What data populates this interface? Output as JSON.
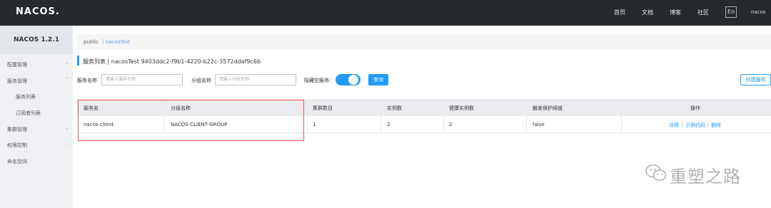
{
  "header": {
    "logo": "NACOS.",
    "nav": [
      "首页",
      "文档",
      "博客",
      "社区"
    ],
    "lang": "En",
    "user": "nacos"
  },
  "sidebar": {
    "version": "NACOS 1.2.1",
    "items": [
      {
        "label": "配置管理",
        "chevron": "⌄"
      },
      {
        "label": "服务管理",
        "chevron": "⌃"
      },
      {
        "label": "服务列表"
      },
      {
        "label": "订阅者列表"
      },
      {
        "label": "集群管理",
        "chevron": "⌄"
      },
      {
        "label": "权限控制",
        "chevron": "⌄"
      },
      {
        "label": "命名空间"
      }
    ]
  },
  "breadcrumb": {
    "public": "public",
    "sep": "|",
    "namespace": "nacosTest"
  },
  "page": {
    "title": "服务列表  |  nacosTest  9403ddc2-f9b1-4220-b22c-3572ddaf9c6b"
  },
  "filters": {
    "service_label": "服务名称",
    "service_placeholder": "请输入服务名称",
    "group_label": "分组名称",
    "group_placeholder": "请输入分组名称",
    "hide_empty_label": "隐藏空服务:",
    "query_button": "查询",
    "create_button": "创建服务"
  },
  "table": {
    "columns": [
      "服务名",
      "分组名称",
      "集群数目",
      "实例数",
      "健康实例数",
      "触发保护阈值",
      "操作"
    ],
    "rows": [
      {
        "service": "nacos-client",
        "group": "NACOS-CLIENT-GROUP",
        "clusters": "1",
        "instances": "2",
        "healthy": "2",
        "protect": "false"
      }
    ],
    "actions": {
      "detail": "详情",
      "sample": "示例代码",
      "delete": "删除",
      "sep": "|"
    }
  },
  "watermark": {
    "text": "重塑之路",
    "icon": "wechat-icon"
  },
  "colors": {
    "accent": "#209bfa",
    "topbar": "#252a2f",
    "highlight": "#e85555"
  }
}
